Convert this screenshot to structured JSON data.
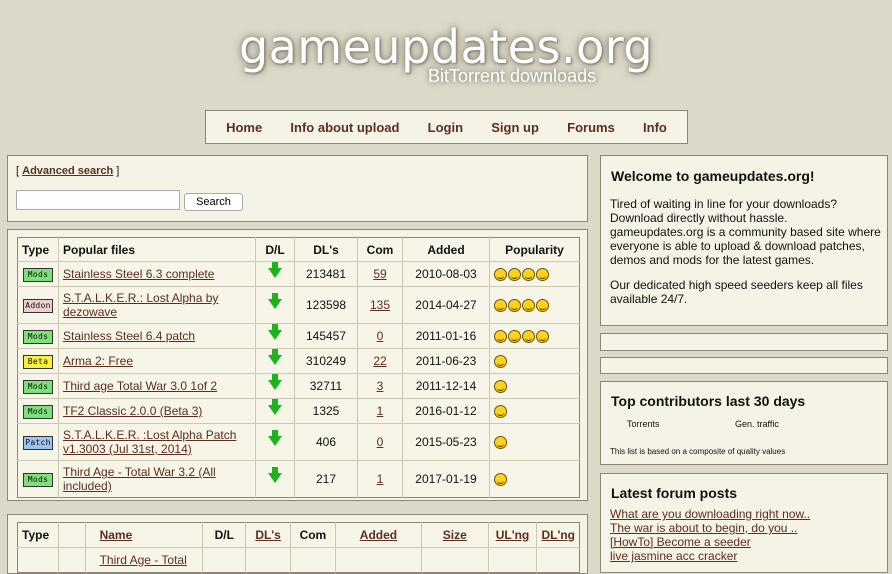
{
  "site": {
    "title": "gameupdates.org",
    "subtitle": "BitTorrent downloads"
  },
  "nav": [
    "Home",
    "Info about upload",
    "Login",
    "Sign up",
    "Forums",
    "Info"
  ],
  "search": {
    "advanced_label": "Advanced search",
    "button": "Search",
    "placeholder": ""
  },
  "popular": {
    "headers": [
      "Type",
      "Popular files",
      "D/L",
      "DL's",
      "Com",
      "Added",
      "Popularity"
    ],
    "rows": [
      {
        "type": "MODS",
        "name": "Stainless Steel 6.3 complete",
        "dls": "213481",
        "com": "59",
        "added": "2010-08-03",
        "popularity": 4
      },
      {
        "type": "ADDON",
        "name": "S.T.A.L.K.E.R.: Lost Alpha by dezowave",
        "dls": "123598",
        "com": "135",
        "added": "2014-04-27",
        "popularity": 4
      },
      {
        "type": "MODS",
        "name": "Stainless Steel 6.4 patch",
        "dls": "145457",
        "com": "0",
        "added": "2011-01-16",
        "popularity": 4
      },
      {
        "type": "BETA",
        "name": "Arma 2: Free",
        "dls": "310249",
        "com": "22",
        "added": "2011-06-23",
        "popularity": 1
      },
      {
        "type": "MODS",
        "name": "Third age Total War 3.0 1of 2",
        "dls": "32711",
        "com": "3",
        "added": "2011-12-14",
        "popularity": 1
      },
      {
        "type": "MODS",
        "name": "TF2 Classic 2.0.0 (Beta 3)",
        "dls": "1325",
        "com": "1",
        "added": "2016-01-12",
        "popularity": 1
      },
      {
        "type": "PATCH",
        "name": "S.T.A.L.K.E.R. :Lost Alpha Patch v1.3003 (Jul 31st, 2014)",
        "dls": "406",
        "com": "0",
        "added": "2015-05-23",
        "popularity": 1
      },
      {
        "type": "MODS",
        "name": "Third Age - Total War 3.2 (All included)",
        "dls": "217",
        "com": "1",
        "added": "2017-01-19",
        "popularity": 1
      }
    ]
  },
  "latest": {
    "headers": [
      "Type",
      "",
      "Name",
      "D/L",
      "DL's",
      "Com",
      "Added",
      "Size",
      "UL'ng",
      "DL'ng"
    ],
    "first_row_name": "Third Age - Total"
  },
  "welcome": {
    "title": "Welcome to gameupdates.org!",
    "p1": "Tired of waiting in line for your downloads? Download directly without hassle. gameupdates.org is a community based site where everyone is able to upload & download patches, demos and mods for the latest games.",
    "p2": "Our dedicated high speed seeders keep all files available 24/7."
  },
  "contributors": {
    "title": "Top contributors last 30 days",
    "tab_torrents": "Torrents",
    "tab_traffic": "Gen. traffic",
    "note": "This list is based on a composite of quality values"
  },
  "forum": {
    "title": "Latest forum posts",
    "posts": [
      "What are you downloading right now..",
      "The war is about to begin, do you ..",
      "[HowTo] Become a seeder",
      "live jasmine acc cracker"
    ]
  },
  "colors": {
    "background": "#dcd9c9",
    "panel": "#f5f2e6",
    "link": "#5b2e1d",
    "arrow": "#1db31d",
    "mods": "#7ee07a",
    "addon": "#f2cfcf",
    "beta": "#f7f03c",
    "patch": "#9cc4f2"
  }
}
